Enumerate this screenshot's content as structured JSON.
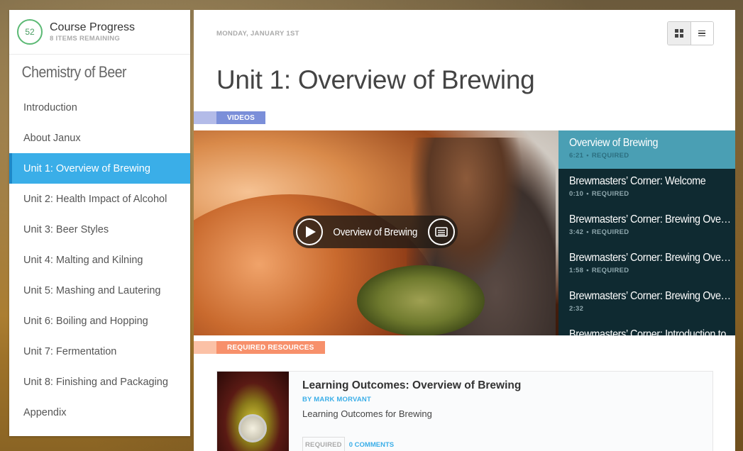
{
  "progress": {
    "value": "52",
    "title": "Course Progress",
    "remaining": "8 ITEMS REMAINING"
  },
  "sidebar": {
    "course_title": "Chemistry of Beer",
    "items": [
      {
        "label": "Introduction"
      },
      {
        "label": "About Janux"
      },
      {
        "label": "Unit 1: Overview of Brewing",
        "active": true
      },
      {
        "label": "Unit 2: Health Impact of Alcohol"
      },
      {
        "label": "Unit 3: Beer Styles"
      },
      {
        "label": "Unit 4: Malting and Kilning"
      },
      {
        "label": "Unit 5: Mashing and Lautering"
      },
      {
        "label": "Unit 6: Boiling and Hopping"
      },
      {
        "label": "Unit 7: Fermentation"
      },
      {
        "label": "Unit 8: Finishing and Packaging"
      },
      {
        "label": "Appendix"
      }
    ]
  },
  "main": {
    "date": "MONDAY, JANUARY 1ST",
    "title": "Unit 1: Overview of Brewing",
    "videos_tag": "VIDEOS",
    "resources_tag": "REQUIRED RESOURCES",
    "video": {
      "label": "Overview of Brewing"
    },
    "playlist": [
      {
        "title": "Overview of Brewing",
        "duration": "6:21",
        "status": "REQUIRED",
        "active": true
      },
      {
        "title": "Brewmasters’ Corner: Welcome",
        "duration": "0:10",
        "status": "REQUIRED"
      },
      {
        "title": "Brewmasters’ Corner: Brewing Overview",
        "duration": "3:42",
        "status": "REQUIRED"
      },
      {
        "title": "Brewmasters’ Corner: Brewing Overview",
        "duration": "1:58",
        "status": "REQUIRED"
      },
      {
        "title": "Brewmasters’ Corner: Brewing Overview",
        "duration": "2:32",
        "status": ""
      },
      {
        "title": "Brewmasters’ Corner: Introduction to",
        "duration": "",
        "status": ""
      }
    ],
    "resource": {
      "title": "Learning Outcomes: Overview of Brewing",
      "author": "BY MARK MORVANT",
      "description": "Learning Outcomes for Brewing",
      "badge": "REQUIRED",
      "comments": "0 COMMENTS"
    }
  },
  "icons": {
    "grid": "grid-view-icon",
    "list": "list-view-icon",
    "play": "play-icon",
    "cc": "closed-captions-icon"
  },
  "colors": {
    "accent": "#3aaee8",
    "progress": "#5bb974",
    "videos_tag": "#7b8fd9",
    "resources_tag": "#f7906b",
    "playlist_bg": "#0f2a31",
    "playlist_active": "#4a9fb4"
  }
}
